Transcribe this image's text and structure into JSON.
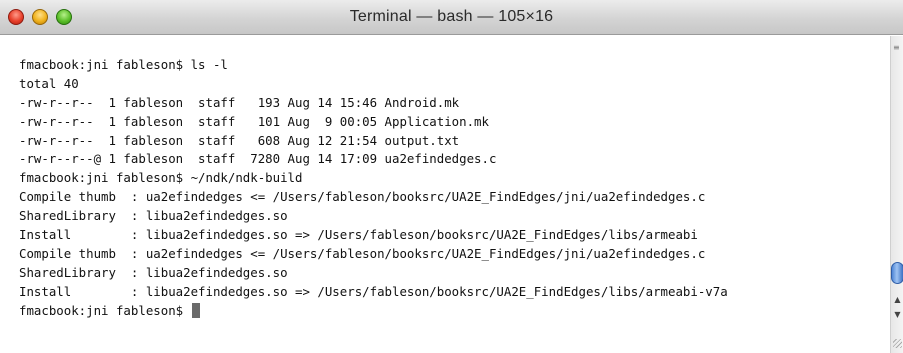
{
  "window": {
    "title": "Terminal — bash — 105×16"
  },
  "terminal": {
    "lines": [
      "fmacbook:jni fableson$ ls -l",
      "total 40",
      "-rw-r--r--  1 fableson  staff   193 Aug 14 15:46 Android.mk",
      "-rw-r--r--  1 fableson  staff   101 Aug  9 00:05 Application.mk",
      "-rw-r--r--  1 fableson  staff   608 Aug 12 21:54 output.txt",
      "-rw-r--r--@ 1 fableson  staff  7280 Aug 14 17:09 ua2efindedges.c",
      "fmacbook:jni fableson$ ~/ndk/ndk-build",
      "Compile thumb  : ua2efindedges <= /Users/fableson/booksrc/UA2E_FindEdges/jni/ua2efindedges.c",
      "SharedLibrary  : libua2efindedges.so",
      "Install        : libua2efindedges.so => /Users/fableson/booksrc/UA2E_FindEdges/libs/armeabi",
      "Compile thumb  : ua2efindedges <= /Users/fableson/booksrc/UA2E_FindEdges/jni/ua2efindedges.c",
      "SharedLibrary  : libua2efindedges.so",
      "Install        : libua2efindedges.so => /Users/fableson/booksrc/UA2E_FindEdges/libs/armeabi-v7a"
    ],
    "prompt": "fmacbook:jni fableson$ "
  },
  "icons": {
    "close": "close-icon",
    "minimize": "minimize-icon",
    "zoom": "zoom-icon",
    "scroll_up": "arrow-up-icon",
    "scroll_down": "arrow-down-icon",
    "resize": "resize-grip-icon"
  },
  "colors": {
    "close": "#e8402b",
    "minimize": "#f0b21d",
    "zoom": "#5cbf2a",
    "scroll_thumb": "#4f86d6",
    "text": "#111111",
    "background": "#ffffff"
  }
}
